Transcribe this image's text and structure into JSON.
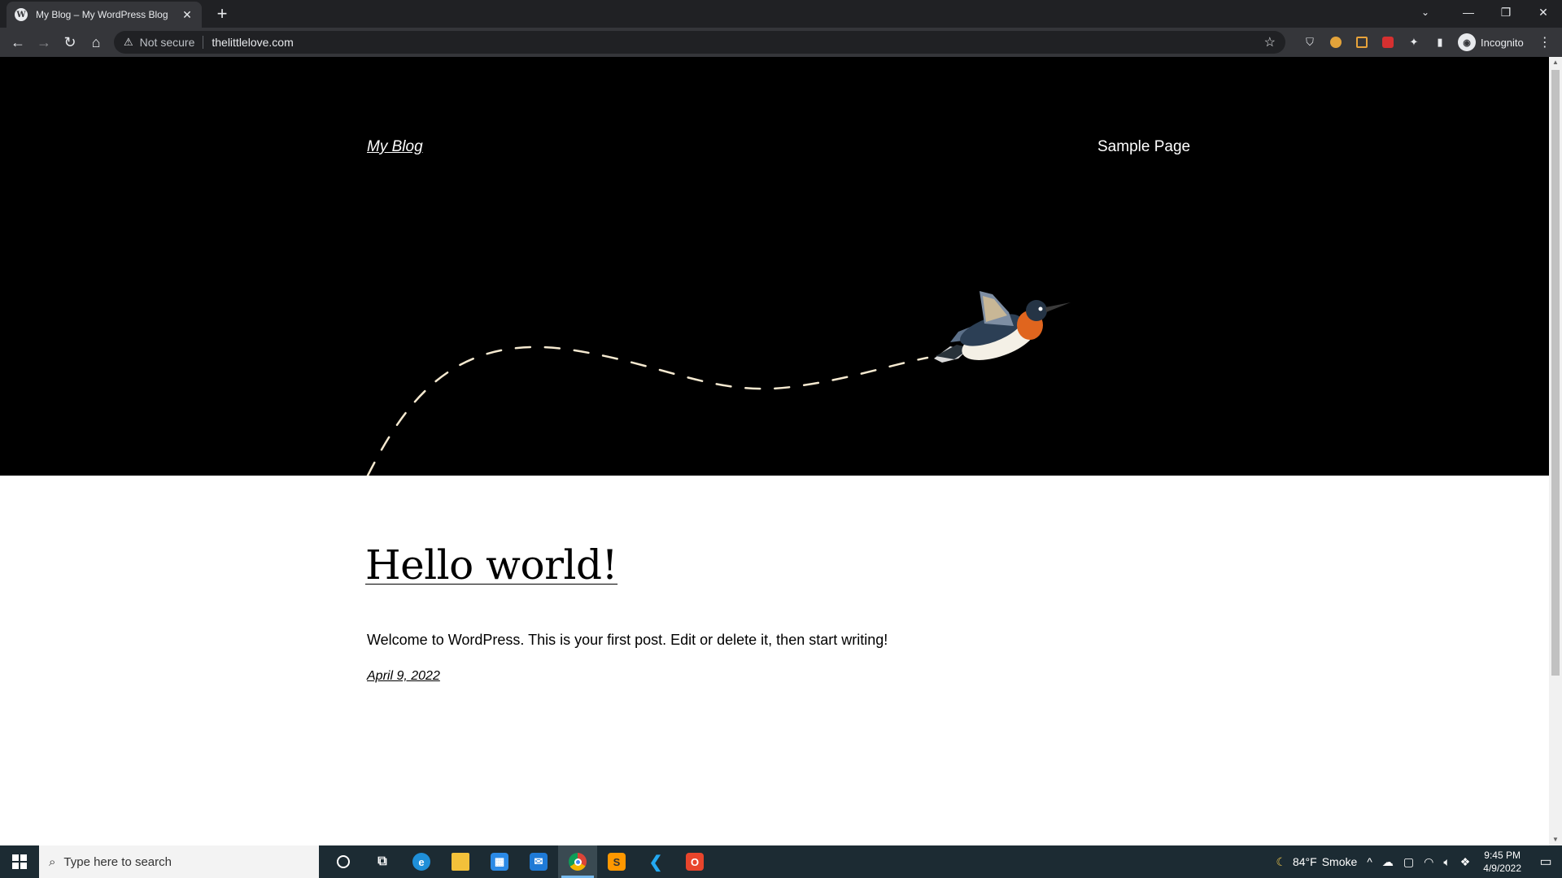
{
  "browser": {
    "tab_title": "My Blog – My WordPress Blog",
    "tab_close": "✕",
    "new_tab": "+",
    "security_label": "Not secure",
    "url": "thelittlelove.com",
    "profile_label": "Incognito"
  },
  "site": {
    "title": "My Blog",
    "nav_items": [
      "Sample Page"
    ]
  },
  "post": {
    "title": "Hello world!",
    "excerpt": "Welcome to WordPress. This is your first post. Edit or delete it, then start writing!",
    "date": "April 9, 2022"
  },
  "taskbar": {
    "search_placeholder": "Type here to search",
    "weather_temp": "84°F",
    "weather_text": "Smoke",
    "time": "9:45 PM",
    "date": "4/9/2022"
  },
  "colors": {
    "hero_bg": "#000000",
    "path_stroke": "#f5e9d0",
    "chrome_dark": "#202124",
    "chrome_toolbar": "#35363a",
    "taskbar_bg": "#1c2b33"
  }
}
